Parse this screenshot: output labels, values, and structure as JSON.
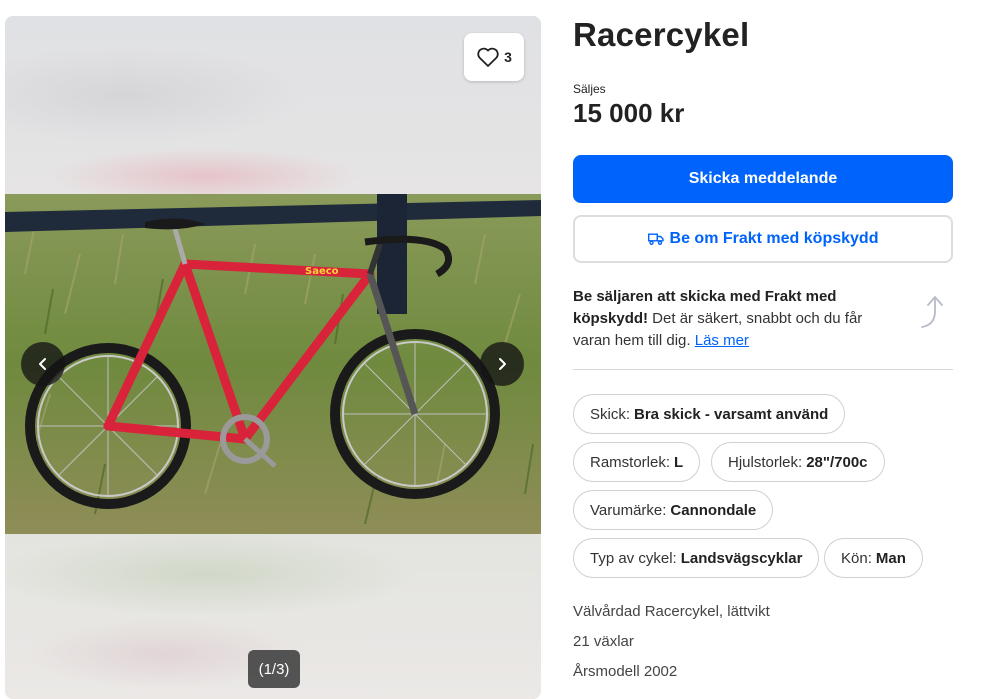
{
  "gallery": {
    "favorite_count": "3",
    "image_counter": "(1/3)",
    "brand_on_frame": "Saeco"
  },
  "listing": {
    "title": "Racercykel",
    "status": "Säljes",
    "price": "15 000 kr"
  },
  "actions": {
    "message_label": "Skicka meddelande",
    "shipping_label": "Be om Frakt med köpskydd"
  },
  "promo": {
    "bold_text": "Be säljaren att skicka med Frakt med köpskydd!",
    "body_text": " Det är säkert, snabbt och du får varan hem till dig. ",
    "link_text": "Läs mer"
  },
  "attributes": [
    {
      "key": "Skick:",
      "value": "Bra skick - varsamt använd"
    },
    {
      "key": "Ramstorlek:",
      "value": "L"
    },
    {
      "key": "Hjulstorlek:",
      "value": "28\"/700c"
    },
    {
      "key": "Varumärke:",
      "value": "Cannondale"
    },
    {
      "key": "Typ av cykel:",
      "value": "Landsvägscyklar"
    },
    {
      "key": "Kön:",
      "value": "Man"
    }
  ],
  "description": [
    "Välvårdad Racercykel,  lättvikt",
    "21 växlar",
    "Årsmodell 2002"
  ],
  "colors": {
    "primary": "#0063fb",
    "frame_red": "#d8233a",
    "border": "#cfd0d4"
  }
}
